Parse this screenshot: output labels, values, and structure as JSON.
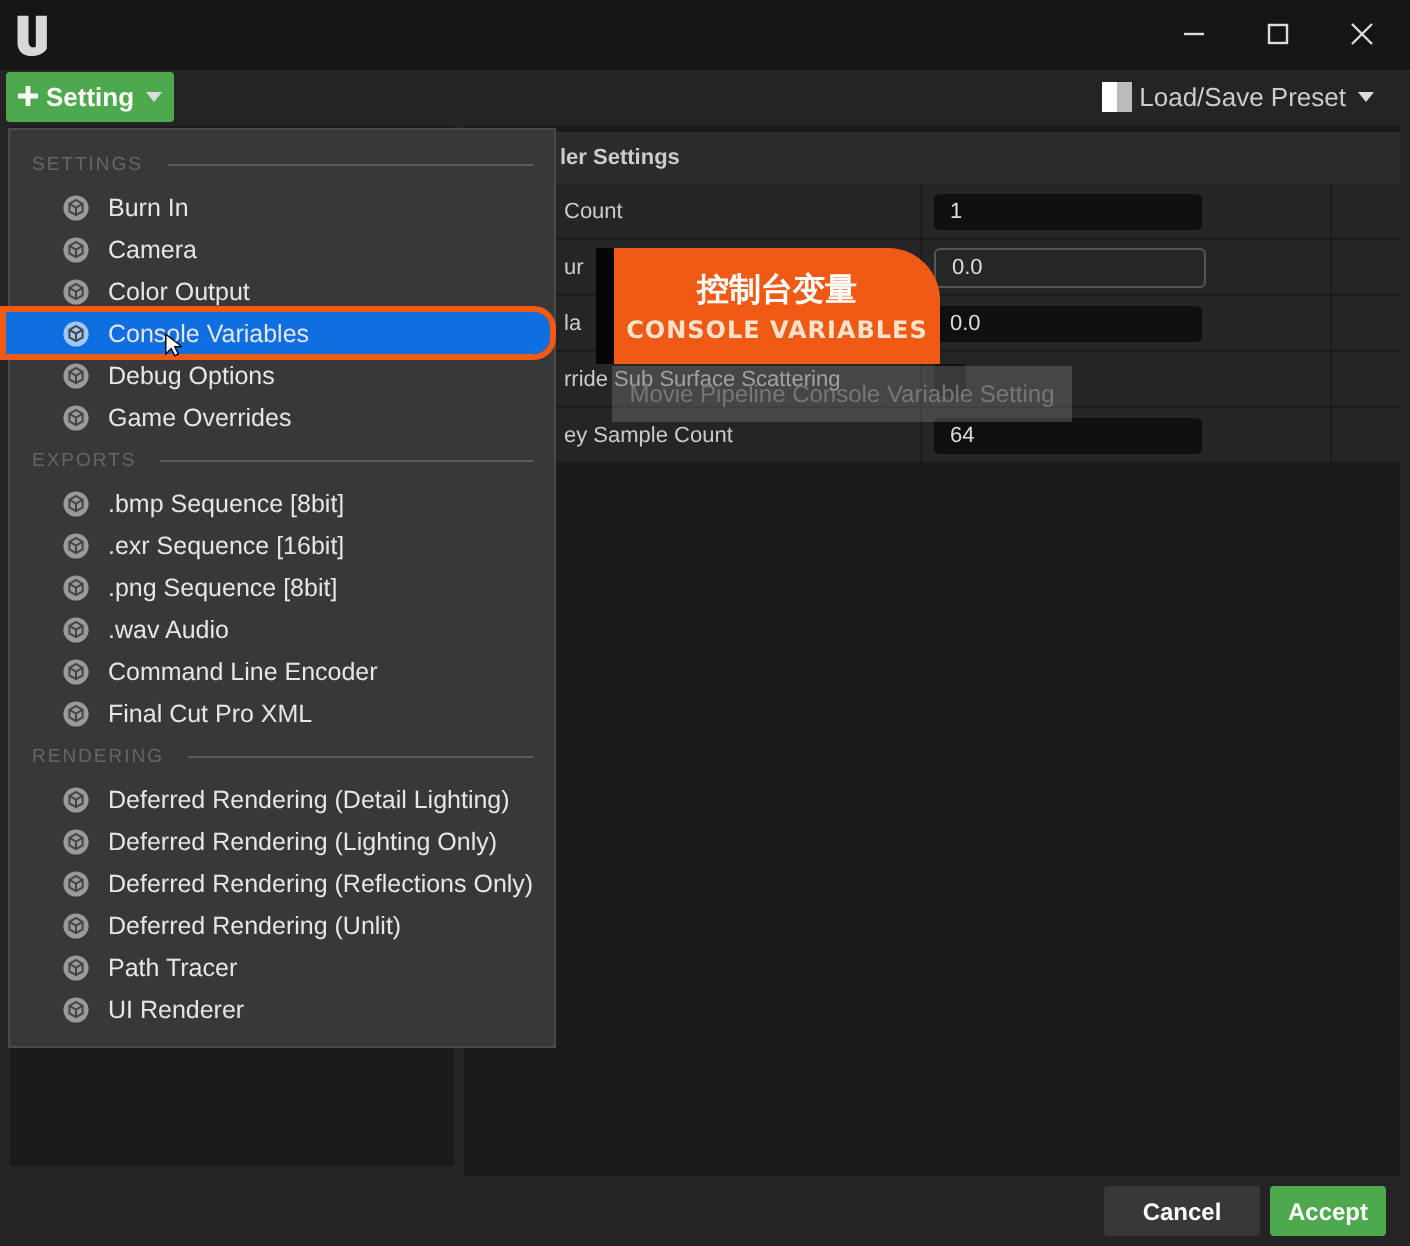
{
  "toolbar": {
    "add_button": "Setting",
    "preset_button": "Load/Save Preset"
  },
  "details": {
    "header": "ler Settings",
    "rows": [
      {
        "label": "Count",
        "kind": "text",
        "value": "1"
      },
      {
        "label": "ur",
        "kind": "text",
        "value": "0.0"
      },
      {
        "label": "la",
        "kind": "text",
        "value": "0.0"
      },
      {
        "label": "rride Sub Surface Scattering",
        "kind": "checkbox",
        "checked": false
      },
      {
        "label": "ey Sample Count",
        "kind": "text",
        "value": "64"
      }
    ]
  },
  "menu": {
    "sections": [
      {
        "title": "SETTINGS",
        "items": [
          {
            "label": "Burn In",
            "selected": false
          },
          {
            "label": "Camera",
            "selected": false
          },
          {
            "label": "Color Output",
            "selected": false
          },
          {
            "label": "Console Variables",
            "selected": true
          },
          {
            "label": "Debug Options",
            "selected": false
          },
          {
            "label": "Game Overrides",
            "selected": false
          }
        ]
      },
      {
        "title": "EXPORTS",
        "items": [
          {
            "label": ".bmp Sequence [8bit]",
            "selected": false
          },
          {
            "label": ".exr Sequence [16bit]",
            "selected": false
          },
          {
            "label": ".png Sequence [8bit]",
            "selected": false
          },
          {
            "label": ".wav Audio",
            "selected": false
          },
          {
            "label": "Command Line Encoder",
            "selected": false
          },
          {
            "label": "Final Cut Pro XML",
            "selected": false
          }
        ]
      },
      {
        "title": "RENDERING",
        "items": [
          {
            "label": "Deferred Rendering (Detail Lighting)",
            "selected": false
          },
          {
            "label": "Deferred Rendering (Lighting Only)",
            "selected": false
          },
          {
            "label": "Deferred Rendering (Reflections Only)",
            "selected": false
          },
          {
            "label": "Deferred Rendering (Unlit)",
            "selected": false
          },
          {
            "label": "Path Tracer",
            "selected": false
          },
          {
            "label": "UI Renderer",
            "selected": false
          }
        ]
      }
    ]
  },
  "callout": {
    "title": "控制台变量",
    "subtitle": "CONSOLE VARIABLES"
  },
  "tooltip": "Movie Pipeline Console Variable Setting",
  "footer": {
    "buttons": [
      {
        "label": "Cancel",
        "kind": "secondary"
      },
      {
        "label": "Accept",
        "kind": "primary"
      }
    ]
  }
}
